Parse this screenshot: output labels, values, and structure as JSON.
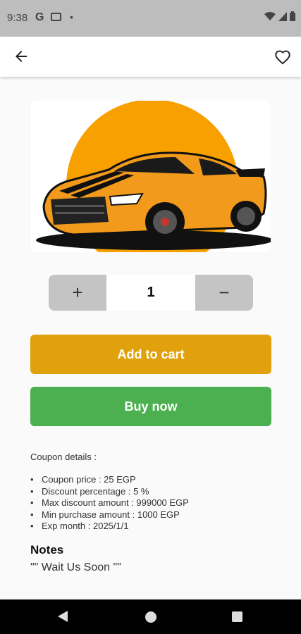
{
  "status_bar": {
    "time": "9:38",
    "g_label": "G",
    "dot": "•"
  },
  "product": {
    "image_alt": "Orange sports car"
  },
  "quantity": {
    "plus": "+",
    "value": "1",
    "minus": "−"
  },
  "actions": {
    "add_to_cart": "Add to cart",
    "buy_now": "Buy now"
  },
  "coupon": {
    "title": "Coupon details :",
    "items": [
      "Coupon price : 25 EGP",
      "Discount percentage : 5 %",
      "Max discount amount : 999000 EGP",
      "Min purchase amount : 1000 EGP",
      "Exp month : 2025/1/1"
    ]
  },
  "notes": {
    "title": "Notes",
    "text": "\"\" Wait Us Soon \"\""
  },
  "colors": {
    "cart": "#e0a10c",
    "buy": "#4caf50",
    "sun": "#f7a000",
    "car": "#f29a1c"
  }
}
